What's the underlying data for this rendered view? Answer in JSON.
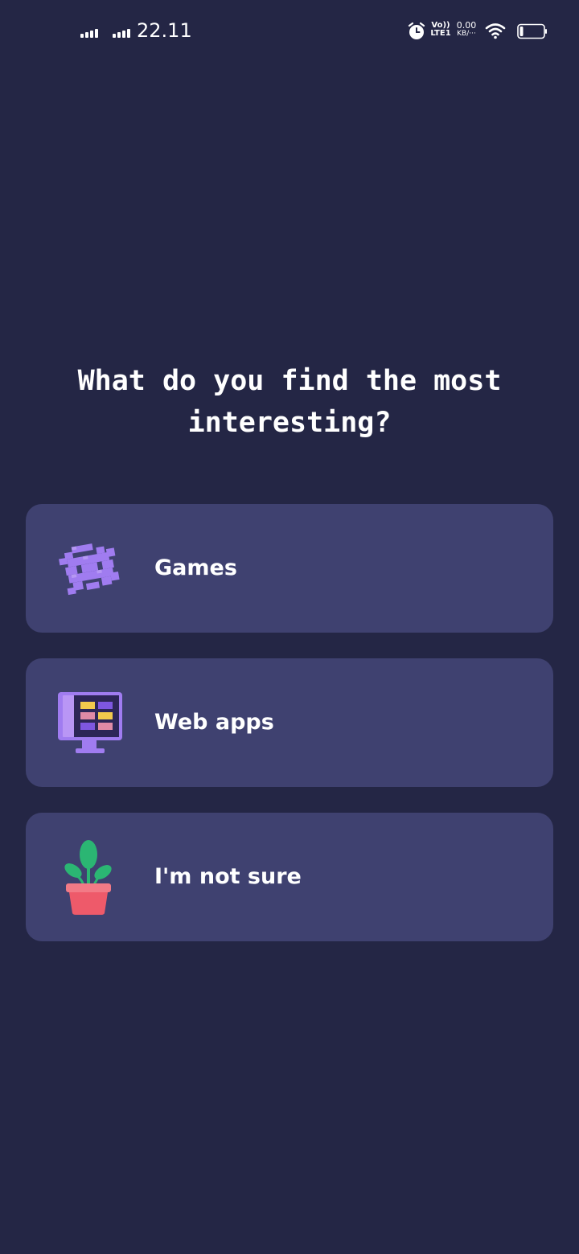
{
  "status_bar": {
    "time": "22.11",
    "volte_top": "Vo))",
    "volte_bottom": "LTE1",
    "net_speed_value": "0.00",
    "net_speed_unit": "KB/···",
    "battery_level": 0.15
  },
  "question": {
    "title": "What do you find the most interesting?"
  },
  "options": [
    {
      "label": "Games",
      "icon": "pixel-creature-icon"
    },
    {
      "label": "Web apps",
      "icon": "monitor-icon"
    },
    {
      "label": "I'm not sure",
      "icon": "potted-plant-icon"
    }
  ],
  "colors": {
    "background": "#242645",
    "card": "#3f4170",
    "text": "#ffffff",
    "accent_purple": "#a07cf0"
  }
}
